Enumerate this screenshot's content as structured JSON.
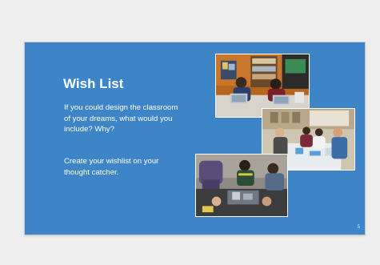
{
  "slide": {
    "title": "Wish List",
    "paragraph_1": "If you could design the classroom of your dreams, what would you include? Why?",
    "paragraph_2": "Create your wishlist on your thought catcher.",
    "slide_number": "5",
    "background_color": "#3d85c6",
    "text_color": "#ffffff"
  },
  "photos": [
    {
      "name": "classroom-photo-students-laptops"
    },
    {
      "name": "classroom-photo-group-table"
    },
    {
      "name": "classroom-photo-hands-on-building"
    }
  ]
}
